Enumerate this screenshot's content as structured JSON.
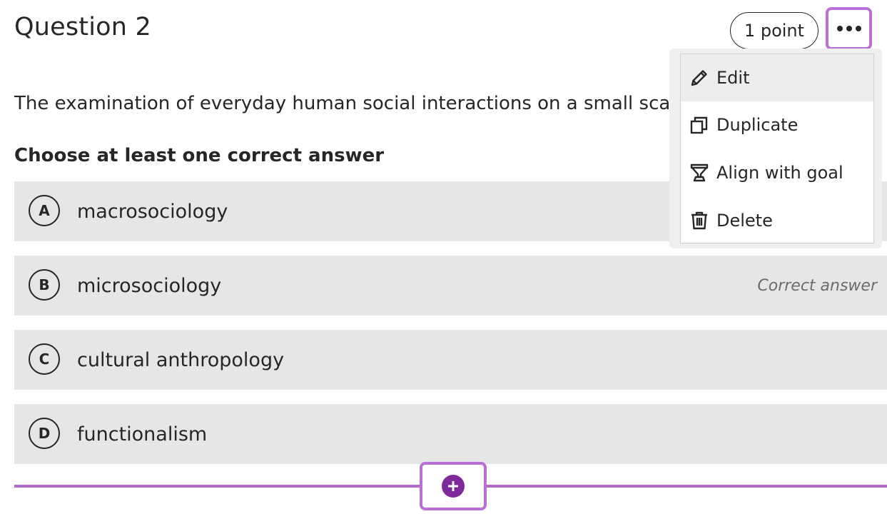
{
  "question": {
    "title": "Question 2",
    "points_label": "1 point",
    "text": "The examination of everyday human social interactions on a small scale",
    "instruction": "Choose at least one correct answer"
  },
  "options": [
    {
      "letter": "A",
      "text": "macrosociology",
      "correct": false
    },
    {
      "letter": "B",
      "text": "microsociology",
      "correct": true,
      "correct_label": "Correct answer"
    },
    {
      "letter": "C",
      "text": "cultural anthropology",
      "correct": false
    },
    {
      "letter": "D",
      "text": "functionalism",
      "correct": false
    }
  ],
  "menu": {
    "items": [
      {
        "label": "Edit",
        "icon": "pencil-icon",
        "highlighted": true
      },
      {
        "label": "Duplicate",
        "icon": "duplicate-icon",
        "highlighted": false
      },
      {
        "label": "Align with goal",
        "icon": "trophy-icon",
        "highlighted": false
      },
      {
        "label": "Delete",
        "icon": "trash-icon",
        "highlighted": false
      }
    ]
  },
  "colors": {
    "accent_purple": "#b96fd6",
    "add_button_purple": "#7e2a9b",
    "option_background": "#e6e6e6"
  }
}
